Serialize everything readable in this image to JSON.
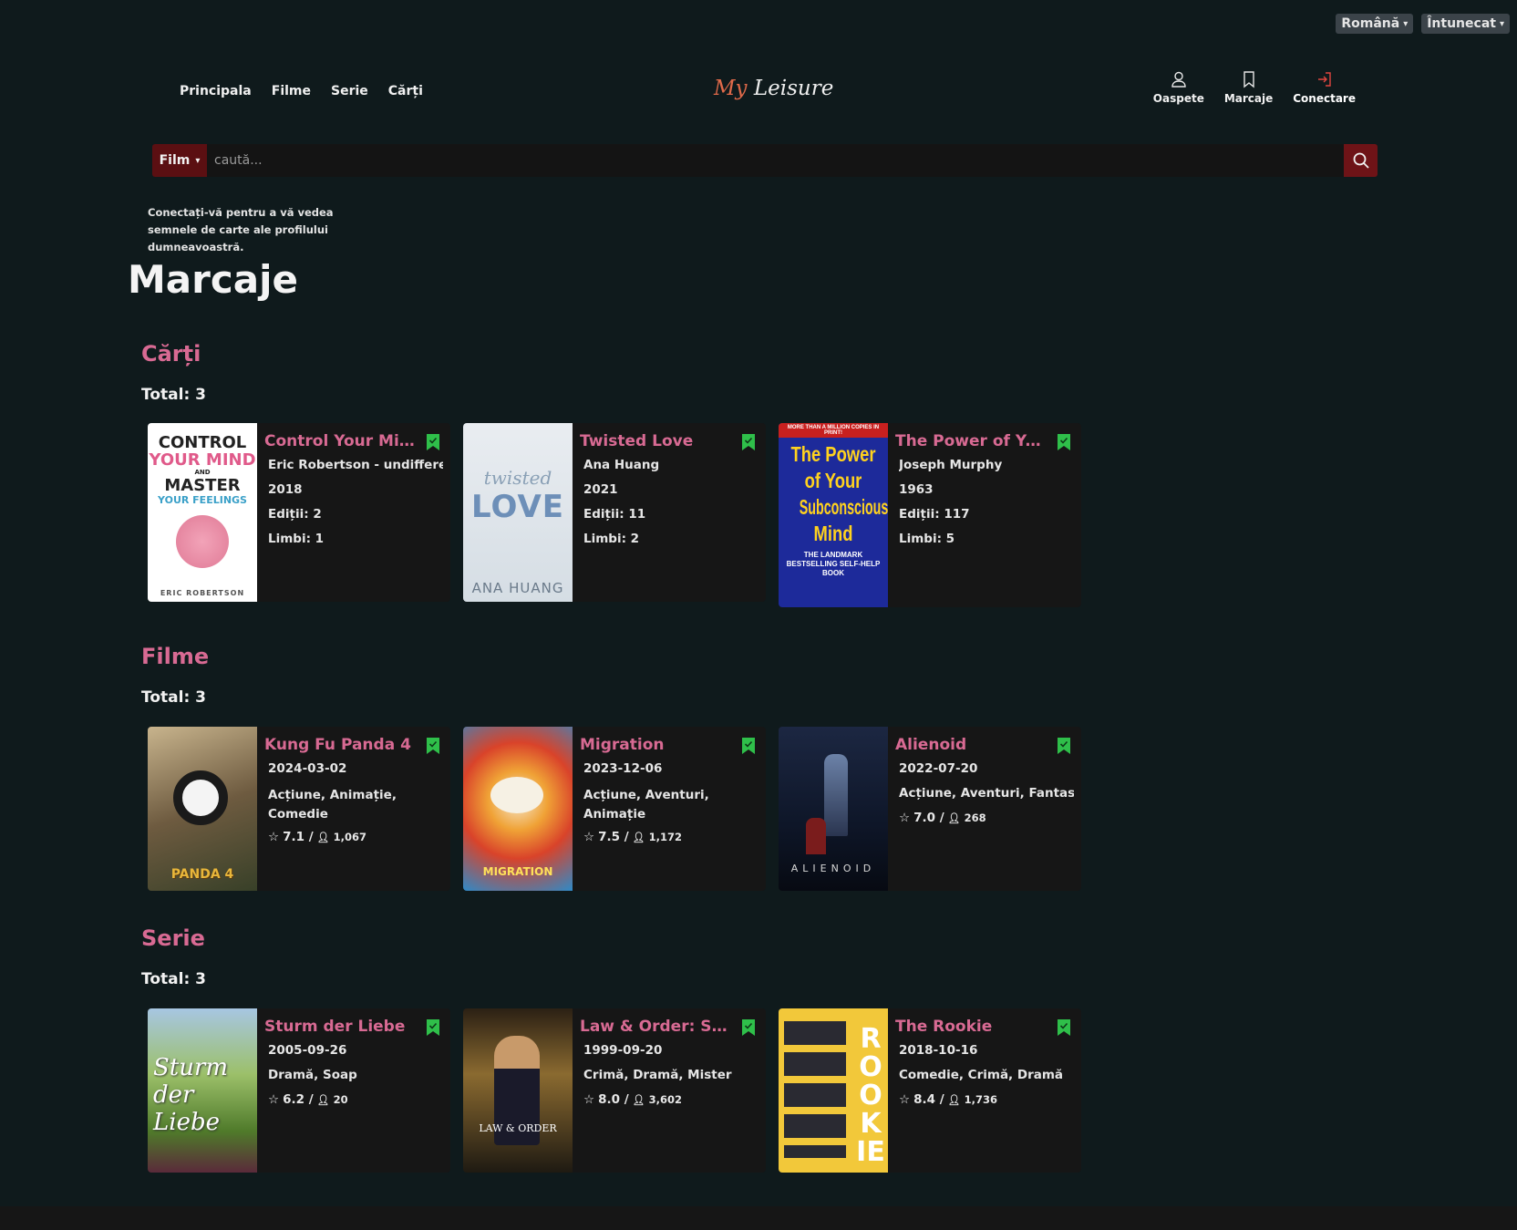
{
  "top_selectors": {
    "language": "Română",
    "theme": "Întunecat"
  },
  "nav": {
    "home": "Principala",
    "movies": "Filme",
    "series": "Serie",
    "books": "Cărți"
  },
  "logo": {
    "my": "My",
    "leisure": "Leisure"
  },
  "actions": {
    "guest": "Oaspete",
    "bookmarks": "Marcaje",
    "login": "Conectare"
  },
  "search": {
    "type": "Film",
    "placeholder": "caută..."
  },
  "note": "Conectați-vă pentru a vă vedea semnele de carte ale profilului dumneavoastră.",
  "page_title": "Marcaje",
  "books": {
    "heading": "Cărți",
    "total": "Total: 3",
    "items": [
      {
        "title": "Control Your Mi...",
        "author": "Eric Robertson - undifferen",
        "year": "2018",
        "editions": "Ediții:  2",
        "languages": "Limbi:  1",
        "cover": {
          "l1": "CONTROL",
          "l2": "YOUR MIND",
          "l3": "AND",
          "l4": "MASTER",
          "l5": "YOUR FEELINGS",
          "author": "ERIC ROBERTSON"
        }
      },
      {
        "title": "Twisted Love",
        "author": "Ana Huang",
        "year": "2021",
        "editions": "Ediții:  11",
        "languages": "Limbi:  2",
        "cover": {
          "l1": "twisted",
          "l2": "LOVE",
          "author": "ANA HUANG"
        }
      },
      {
        "title": "The Power of Yo...",
        "author": "Joseph Murphy",
        "year": "1963",
        "editions": "Ediții:  117",
        "languages": "Limbi:  5",
        "cover": {
          "top": "MORE THAN A MILLION COPIES IN PRINT!",
          "l1": "The Power",
          "l2": "of Your",
          "l3": "Subconscious",
          "l4": "Mind",
          "sub": "THE LANDMARK BESTSELLING SELF-HELP BOOK"
        }
      }
    ]
  },
  "movies": {
    "heading": "Filme",
    "total": "Total: 3",
    "items": [
      {
        "title": "Kung Fu Panda 4",
        "date": "2024-03-02",
        "genres": "Acțiune,  Animație,  Comedie",
        "rating": "7.1 /",
        "votes": "1,067",
        "cover_text": "PANDA 4"
      },
      {
        "title": "Migration",
        "date": "2023-12-06",
        "genres": "Acțiune,  Aventuri,  Animație",
        "rating": "7.5 /",
        "votes": "1,172",
        "cover_text": "MIGRATION"
      },
      {
        "title": "Alienoid",
        "date": "2022-07-20",
        "genres": "Acțiune,  Aventuri,  Fantasy",
        "rating": "7.0 /",
        "votes": "268",
        "cover_text": "ALIENOID"
      }
    ]
  },
  "series": {
    "heading": "Serie",
    "total": "Total: 3",
    "items": [
      {
        "title": "Sturm der Liebe",
        "date": "2005-09-26",
        "genres": "Dramă,  Soap",
        "rating": "6.2 /",
        "votes": "20",
        "cover_text": "Sturm der Liebe"
      },
      {
        "title": "Law & Order: Sp...",
        "date": "1999-09-20",
        "genres": "Crimă,  Dramă,  Mister",
        "rating": "8.0 /",
        "votes": "3,602",
        "cover_text": "LAW & ORDER"
      },
      {
        "title": "The Rookie",
        "date": "2018-10-16",
        "genres": "Comedie,  Crimă,  Dramă",
        "rating": "8.4 /",
        "votes": "1,736",
        "cover_text": "ROOKIE"
      }
    ]
  },
  "colors": {
    "background": "#0f1a1c",
    "accent_pink": "#d86a93",
    "bookmark_green": "#2fbf4a",
    "search_red": "#6e1317"
  }
}
